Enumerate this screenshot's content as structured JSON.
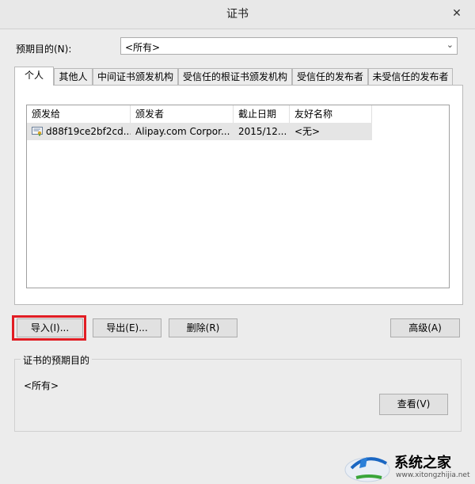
{
  "window": {
    "title": "证书",
    "close_glyph": "✕"
  },
  "purpose": {
    "label": "预期目的(N):",
    "selected": "<所有>"
  },
  "tabs": [
    "个人",
    "其他人",
    "中间证书颁发机构",
    "受信任的根证书颁发机构",
    "受信任的发布者",
    "未受信任的发布者"
  ],
  "table": {
    "columns": [
      "颁发给",
      "颁发者",
      "截止日期",
      "友好名称"
    ],
    "rows": [
      {
        "issued_to": "d88f19ce2bf2cd...",
        "issuer": "Alipay.com Corpor...",
        "expires": "2015/12...",
        "friendly": "<无>",
        "icon": "certificate-icon"
      }
    ]
  },
  "buttons": {
    "import": "导入(I)...",
    "export": "导出(E)...",
    "remove": "删除(R)",
    "advanced": "高级(A)",
    "view": "查看(V)"
  },
  "purposes_group": {
    "title": "证书的预期目的",
    "value": "<所有>"
  },
  "watermark": {
    "text": "系统之家",
    "url": "www.xitongzhijia.net"
  },
  "colors": {
    "highlight": "#e11d24",
    "window_bg": "#ececec"
  }
}
